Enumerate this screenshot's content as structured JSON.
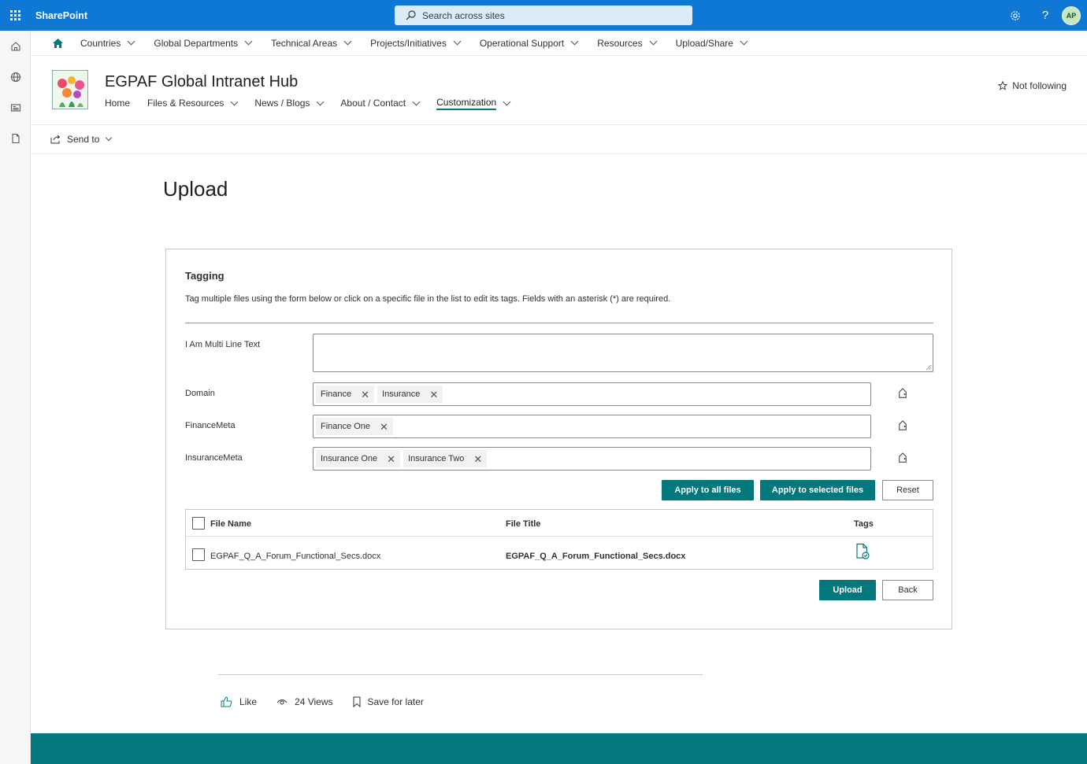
{
  "suite": {
    "brand": "SharePoint",
    "search_placeholder": "Search across sites",
    "avatar_initials": "AP",
    "accent_color": "#0f78d4"
  },
  "hub_nav": {
    "items": [
      {
        "label": "Countries"
      },
      {
        "label": "Global Departments"
      },
      {
        "label": "Technical Areas"
      },
      {
        "label": "Projects/Initiatives"
      },
      {
        "label": "Operational Support"
      },
      {
        "label": "Resources"
      },
      {
        "label": "Upload/Share"
      }
    ]
  },
  "site": {
    "title": "EGPAF Global Intranet Hub",
    "nav": [
      {
        "label": "Home"
      },
      {
        "label": "Files & Resources"
      },
      {
        "label": "News / Blogs"
      },
      {
        "label": "About / Contact"
      },
      {
        "label": "Customization"
      }
    ],
    "follow_label": "Not following"
  },
  "command_bar": {
    "send_to_label": "Send to"
  },
  "page": {
    "title": "Upload"
  },
  "tagging": {
    "title": "Tagging",
    "description": "Tag multiple files using the form below or click on a specific file in the list to edit its tags. Fields with an asterisk (*) are required.",
    "fields": {
      "multiline": {
        "label": "I Am Multi Line Text",
        "value": ""
      },
      "domain": {
        "label": "Domain",
        "tags": [
          "Finance",
          "Insurance"
        ]
      },
      "finance_meta": {
        "label": "FinanceMeta",
        "tags": [
          "Finance One"
        ]
      },
      "insurance_meta": {
        "label": "InsuranceMeta",
        "tags": [
          "Insurance One",
          "Insurance Two"
        ]
      }
    },
    "buttons": {
      "apply_all": "Apply to all files",
      "apply_selected": "Apply to selected files",
      "reset": "Reset",
      "upload": "Upload",
      "back": "Back"
    },
    "table": {
      "columns": [
        "File Name",
        "File Title",
        "Tags"
      ],
      "rows": [
        {
          "file_name": "EGPAF_Q_A_Forum_Functional_Secs.docx",
          "file_title": "EGPAF_Q_A_Forum_Functional_Secs.docx"
        }
      ]
    },
    "theme_color": "#03787c"
  },
  "social": {
    "like": "Like",
    "views": "24 Views",
    "save": "Save for later"
  },
  "tag_remove_glyph": "✕"
}
